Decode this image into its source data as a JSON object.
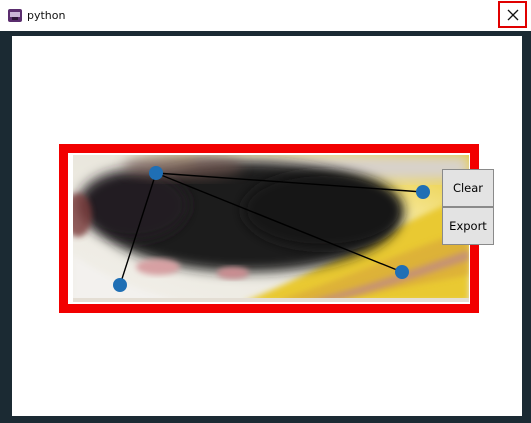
{
  "window": {
    "title": "python",
    "close_icon": "close-icon"
  },
  "buttons": {
    "clear": "Clear",
    "export": "Export"
  },
  "colors": {
    "highlight": "#f20000",
    "point": "#1f6fb5",
    "frame": "#1b2a33"
  },
  "annotation": {
    "points": [
      {
        "id": 1,
        "color": "#1f6fb5"
      },
      {
        "id": 2,
        "color": "#1f6fb5"
      },
      {
        "id": 3,
        "color": "#1f6fb5"
      },
      {
        "id": 4,
        "color": "#1f6fb5"
      }
    ],
    "edges": [
      [
        1,
        2
      ],
      [
        1,
        3
      ],
      [
        1,
        4
      ]
    ]
  }
}
